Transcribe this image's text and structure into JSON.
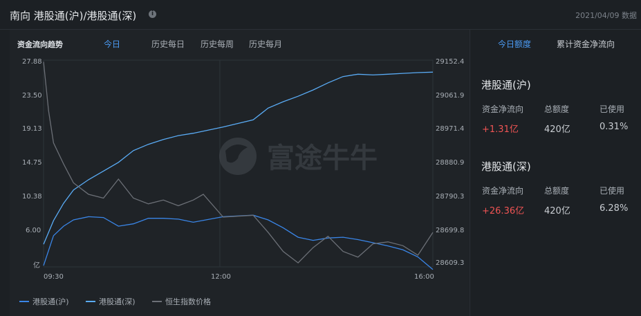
{
  "header": {
    "title": "南向 港股通(沪)/港股通(深)",
    "date": "2021/04/09 数据",
    "info_icon": "info-icon"
  },
  "chart_panel": {
    "label": "资金流向趋势",
    "tabs": [
      "今日",
      "历史每日",
      "历史每周",
      "历史每月"
    ],
    "active_tab": "今日"
  },
  "watermark": "富途牛牛",
  "colors": {
    "accent": "#4c9cf5",
    "sh_line": "#3a86e8",
    "sz_line": "#5aacf6",
    "hsi_line": "#6c7077",
    "positive": "#f05454"
  },
  "chart_data": {
    "type": "line",
    "left_axis": {
      "ticks": [
        "27.88",
        "23.50",
        "19.13",
        "14.75",
        "10.38",
        "6.00",
        "亿"
      ],
      "range": [
        1.63,
        27.88
      ]
    },
    "right_axis": {
      "ticks": [
        "29152.4",
        "29061.9",
        "28971.4",
        "28880.9",
        "28790.3",
        "28699.8",
        "28609.3"
      ],
      "range": [
        28609.3,
        29152.4
      ]
    },
    "x_ticks": [
      "09:30",
      "12:00",
      "16:00"
    ],
    "series": [
      {
        "name": "港股通(沪)",
        "axis": "left",
        "x": [
          "09:30",
          "09:40",
          "09:50",
          "10:00",
          "10:15",
          "10:30",
          "10:45",
          "11:00",
          "11:15",
          "11:30",
          "11:45",
          "12:00",
          "12:30",
          "13:00",
          "13:15",
          "13:30",
          "13:45",
          "14:00",
          "14:15",
          "14:30",
          "14:45",
          "15:00",
          "15:15",
          "15:30",
          "15:45",
          "16:00"
        ],
        "values": [
          1.8,
          5.6,
          6.8,
          7.6,
          8.0,
          7.9,
          6.8,
          7.1,
          7.8,
          7.8,
          7.7,
          7.3,
          8.0,
          8.2,
          7.6,
          6.6,
          5.4,
          5.0,
          5.3,
          5.4,
          5.1,
          4.7,
          4.3,
          3.8,
          2.9,
          1.3
        ]
      },
      {
        "name": "港股通(深)",
        "axis": "left",
        "x": [
          "09:30",
          "09:40",
          "09:50",
          "10:00",
          "10:15",
          "10:30",
          "10:45",
          "11:00",
          "11:15",
          "11:30",
          "11:45",
          "12:00",
          "12:30",
          "13:00",
          "13:15",
          "13:30",
          "13:45",
          "14:00",
          "14:15",
          "14:30",
          "14:45",
          "15:00",
          "15:15",
          "15:30",
          "15:45",
          "16:00"
        ],
        "values": [
          4.5,
          7.5,
          9.7,
          11.4,
          12.7,
          13.8,
          14.9,
          16.4,
          17.2,
          17.8,
          18.3,
          18.6,
          19.4,
          20.3,
          21.8,
          22.6,
          23.3,
          24.1,
          25.0,
          25.8,
          26.1,
          26.0,
          26.1,
          26.2,
          26.3,
          26.36
        ]
      },
      {
        "name": "恒生指数价格",
        "axis": "right",
        "x": [
          "09:30",
          "09:35",
          "09:40",
          "09:50",
          "10:00",
          "10:15",
          "10:30",
          "10:45",
          "11:00",
          "11:15",
          "11:30",
          "11:45",
          "12:00",
          "12:10",
          "12:30",
          "13:00",
          "13:15",
          "13:30",
          "13:45",
          "14:00",
          "14:15",
          "14:30",
          "14:45",
          "15:00",
          "15:15",
          "15:30",
          "15:45",
          "16:00"
        ],
        "values": [
          29148,
          29020,
          28935,
          28880,
          28830,
          28800,
          28790,
          28840,
          28790,
          28775,
          28785,
          28770,
          28785,
          28800,
          28740,
          28745,
          28700,
          28650,
          28620,
          28660,
          28690,
          28650,
          28635,
          28670,
          28675,
          28665,
          28640,
          28700
        ]
      }
    ]
  },
  "side_panel": {
    "tabs": [
      "今日额度",
      "累计资金净流向"
    ],
    "active_tab": "今日额度",
    "columns": [
      "资金净流向",
      "总额度",
      "已使用"
    ],
    "sections": [
      {
        "title": "港股通(沪)",
        "net_flow": "+1.31亿",
        "total_quota": "420亿",
        "used": "0.31%"
      },
      {
        "title": "港股通(深)",
        "net_flow": "+26.36亿",
        "total_quota": "420亿",
        "used": "6.28%"
      }
    ]
  }
}
